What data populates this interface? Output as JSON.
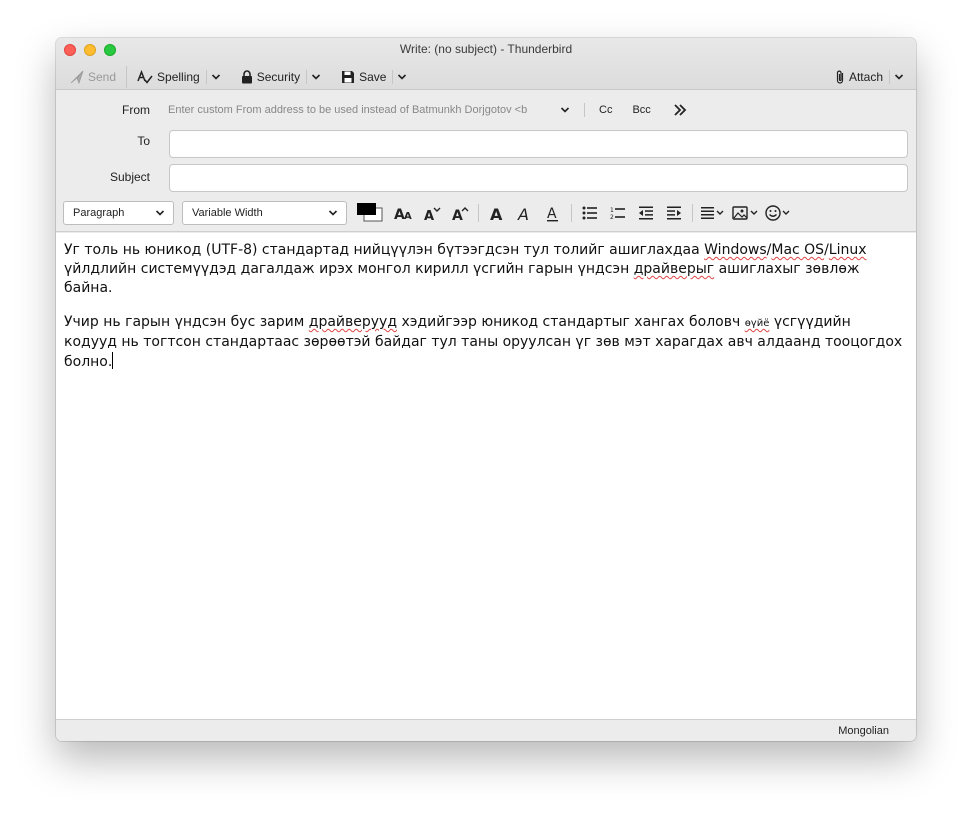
{
  "window": {
    "title": "Write: (no subject) - Thunderbird"
  },
  "toolbar": {
    "send_label": "Send",
    "spelling_label": "Spelling",
    "security_label": "Security",
    "save_label": "Save",
    "attach_label": "Attach"
  },
  "header": {
    "from_label": "From",
    "from_placeholder": "Enter custom From address to be used instead of Batmunkh Dorjgotov <b",
    "cc_label": "Cc",
    "bcc_label": "Bcc",
    "to_label": "To",
    "subject_label": "Subject",
    "to_value": "",
    "subject_value": ""
  },
  "format": {
    "paragraph_select": "Paragraph",
    "font_select": "Variable Width"
  },
  "body": {
    "p1_a": "Уг толь нь юникод (UTF-8) стандартад нийцүүлэн бүтээгдсэн тул толийг ашиглахдаа ",
    "p1_windows": "Windows",
    "p1_slash1": "/",
    "p1_macos": "Mac OS",
    "p1_slash2": "/",
    "p1_linux": "Linux",
    "p1_b": " үйлдлийн системүүдэд дагалдаж ирэх монгол кирилл үсгийн гарын үндсэн ",
    "p1_drivers": "драйверыг",
    "p1_c": " ашиглахыг зөвлөж байна.",
    "p2_a": "Учир нь гарын үндсэн бус зарим ",
    "p2_drivers": "драйверууд",
    "p2_b": " хэдийгээр юникод стандартыг хангах боловч ",
    "p2_letters": "өүйё",
    "p2_c": " үсгүүдийн кодууд нь тогтсон стандартаас зөрөөтэй байдаг тул таны оруулсан үг зөв мэт харагдах авч алдааnd тооцогдох болно."
  },
  "status": {
    "language": "Mongolian"
  },
  "colors": {
    "text_color": "#000000",
    "background_color": "#ffffff",
    "spell_underline": "#e04444"
  }
}
